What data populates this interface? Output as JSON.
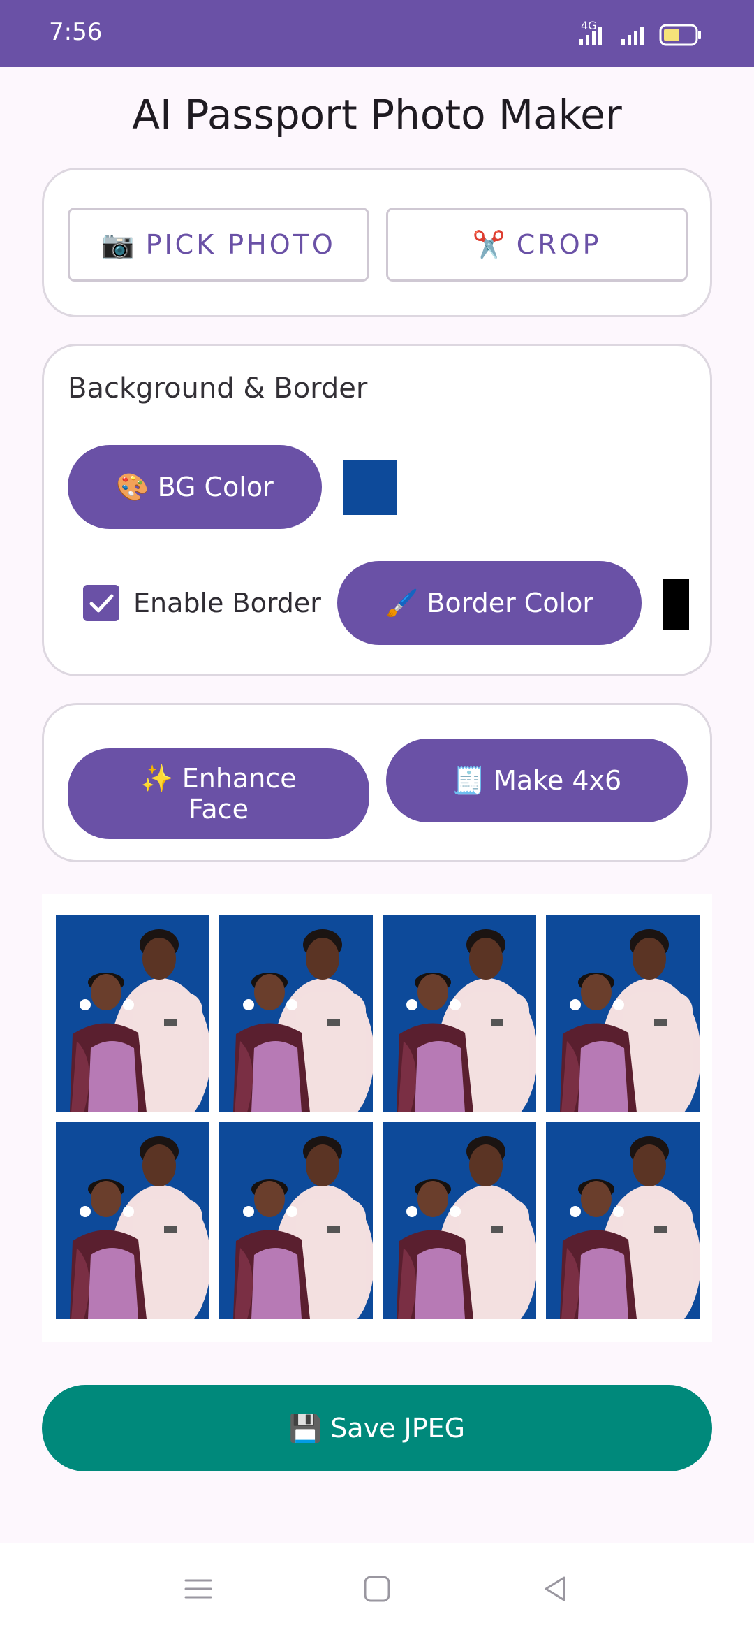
{
  "status_bar": {
    "time": "7:56",
    "network": "4G",
    "background_color": "#6A51A6"
  },
  "app": {
    "title": "AI Passport Photo Maker",
    "accent_color": "#6A51A6",
    "save_color": "#00897B"
  },
  "toolbar": {
    "pick_photo": {
      "emoji": "📷",
      "label": "PICK PHOTO"
    },
    "crop": {
      "emoji": "✂️",
      "label": "CROP"
    }
  },
  "background_border": {
    "title": "Background & Border",
    "bg_color_button": {
      "emoji": "🎨",
      "label": "BG Color"
    },
    "bg_color_value": "#0D4A9A",
    "enable_border_label": "Enable Border",
    "enable_border_checked": true,
    "border_color_button": {
      "emoji": "🖌️",
      "label": "Border Color"
    },
    "border_color_value": "#000000"
  },
  "actions": {
    "enhance_face": {
      "emoji": "✨",
      "label_line1": "Enhance",
      "label_line2": "Face"
    },
    "make_4x6": {
      "emoji": "🧾",
      "label": "Make 4x6"
    }
  },
  "preview": {
    "rows": 2,
    "columns": 4
  },
  "save": {
    "emoji": "💾",
    "label": "Save JPEG"
  },
  "nav": {
    "menu_icon": "menu-icon",
    "home_icon": "home-icon",
    "back_icon": "back-icon"
  }
}
